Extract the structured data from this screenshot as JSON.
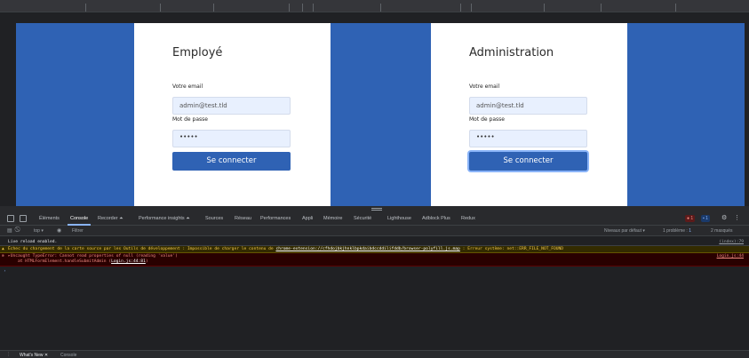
{
  "page": {
    "employee": {
      "title": "Employé",
      "email_label": "Votre email",
      "email_value": "admin@test.tld",
      "password_label": "Mot de passe",
      "password_value": "•••••",
      "submit_label": "Se connecter"
    },
    "admin": {
      "title": "Administration",
      "email_label": "Votre email",
      "email_value": "admin@test.tld",
      "password_label": "Mot de passe",
      "password_value": "•••••",
      "submit_label": "Se connecter"
    },
    "colors": {
      "brand": "#2f62b4",
      "input_bg": "#e8f0fe"
    }
  },
  "devtools": {
    "tabs": [
      "Éléments",
      "Console",
      "Recorder ⏶",
      "Performance insights ⏶",
      "Sources",
      "Réseau",
      "Performances",
      "Appli",
      "Mémoire",
      "Sécurité",
      "Lighthouse",
      "Adblock Plus",
      "Redux"
    ],
    "active_tab": "Console",
    "error_count": "1",
    "message_count": "1",
    "toolbar": {
      "context": "top ▾",
      "filter_placeholder": "Filtrer",
      "levels": "Niveaux par défaut ▾",
      "issues": "1 problème :",
      "issues_count": "1",
      "hidden": "2 masqués"
    },
    "console": {
      "info": {
        "text": "Live reload enabled.",
        "source": "(index):79"
      },
      "warning": {
        "prefix": "Échec du chargement de la carte source par les Outils de développement : Impossible de charger le contenu de ",
        "link": "chrome-extension://cfhdojbkjhnklbpkdaibdccddilifddb/browser-polyfill.js.map",
        "suffix": " : Erreur système: net::ERR_FILE_NOT_FOUND"
      },
      "error": {
        "line1": "▸Uncaught TypeError: Cannot read properties of null (reading 'value')",
        "line2_prefix": "at HTMLFormElement.handleSubmitAdmin (",
        "line2_link": "Login.js:44:81",
        "line2_suffix": ")",
        "source": "Login.js:44"
      },
      "prompt": "›"
    },
    "drawer": {
      "whats_new": "What's New ✕",
      "console": "Console"
    }
  }
}
